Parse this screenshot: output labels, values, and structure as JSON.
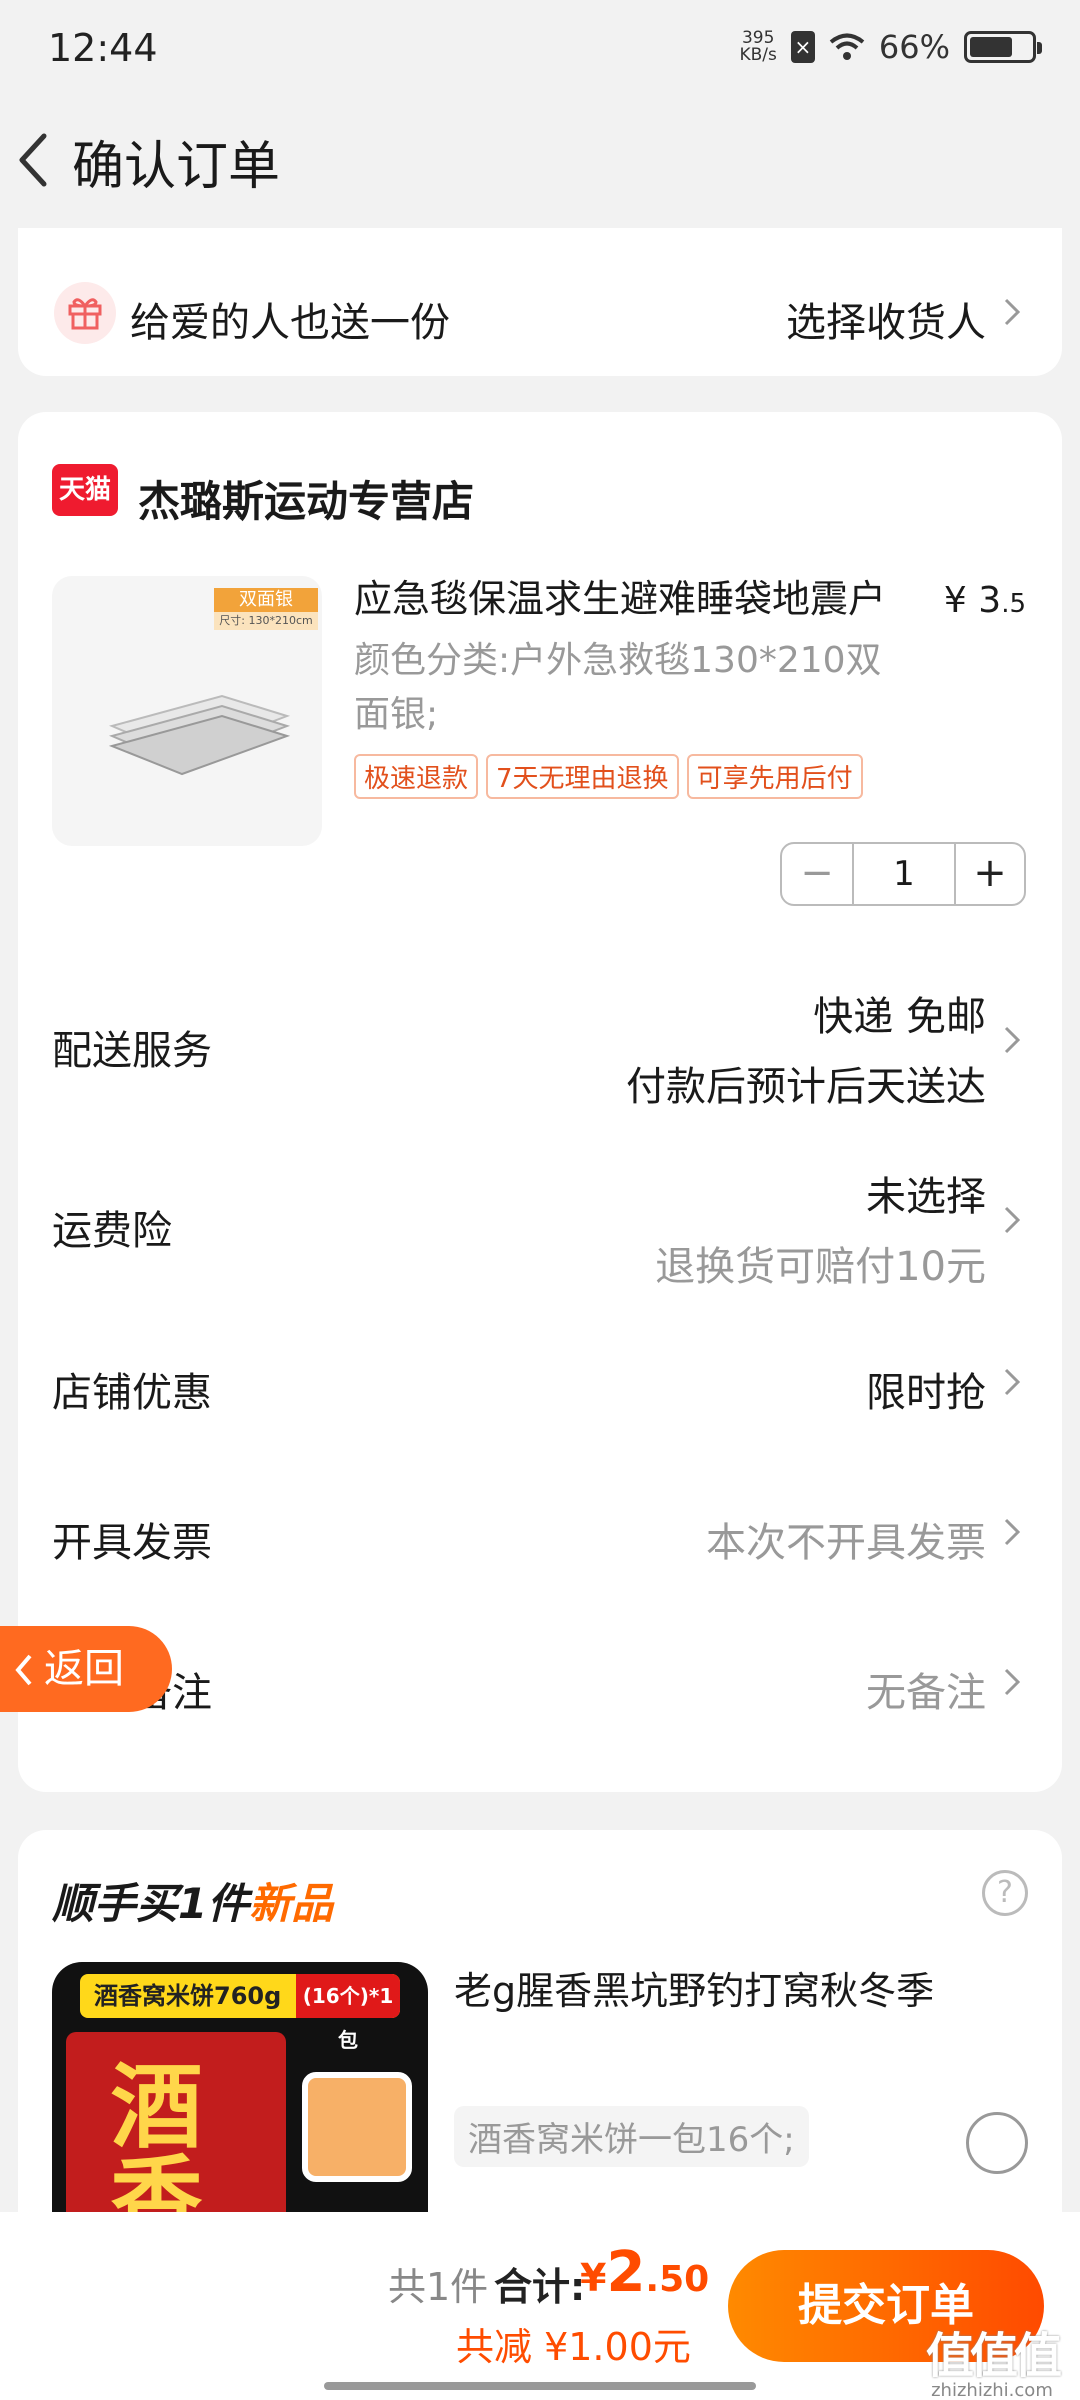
{
  "status_bar": {
    "time": "12:44",
    "net_speed_value": "395",
    "net_speed_unit": "KB/s",
    "battery_percent": "66%",
    "battery_level": 0.66
  },
  "nav": {
    "title": "确认订单"
  },
  "gift": {
    "text": "给爱的人也送一份",
    "action": "选择收货人"
  },
  "shop": {
    "logo_text": "天猫",
    "name": "杰璐斯运动专营店"
  },
  "product": {
    "badge_top": "双面银",
    "badge_bottom": "尺寸: 130*210cm",
    "title": "应急毯保温求生避难睡袋地震户",
    "price_symbol": "¥",
    "price_int": "3",
    "price_dec": ".5",
    "sku": "颜色分类:户外急救毯130*210双面银;",
    "tags": [
      "极速退款",
      "7天无理由退换",
      "可享先用后付"
    ],
    "quantity": "1",
    "minus": "−",
    "plus": "+"
  },
  "rows": {
    "delivery_label": "配送服务",
    "delivery_value1": "快递 免邮",
    "delivery_value2": "付款后预计后天送达",
    "insurance_label": "运费险",
    "insurance_value1": "未选择",
    "insurance_value2": "退换货可赔付10元",
    "discount_label": "店铺优惠",
    "discount_value": "限时抢",
    "invoice_label": "开具发票",
    "invoice_value": "本次不开具发票",
    "note_label": "订单备注",
    "note_value": "无备注"
  },
  "float_back": {
    "label": "返回"
  },
  "addon": {
    "title_prefix": "顺手买1件",
    "title_highlight": "新品",
    "help": "?",
    "img_band": "酒香窝米饼760g",
    "img_band_tag": "(16个)*1包",
    "img_pack_text": "酒香",
    "name": "老g腥香黑坑野钓打窝秋冬季",
    "sku": "酒香窝米饼一包16个;"
  },
  "bottom": {
    "count": "共1件",
    "total_label": "合计:",
    "price_symbol": "¥",
    "price_int": "2",
    "price_dec": ".50",
    "discount": "共减 ¥1.00元",
    "submit": "提交订单",
    "watermark_big": "值值值",
    "watermark_small": "zhizhizhi.com"
  },
  "colors": {
    "accent": "#ff4c00",
    "tmall_red": "#ef1b2f",
    "tag_orange": "#e2501c"
  }
}
